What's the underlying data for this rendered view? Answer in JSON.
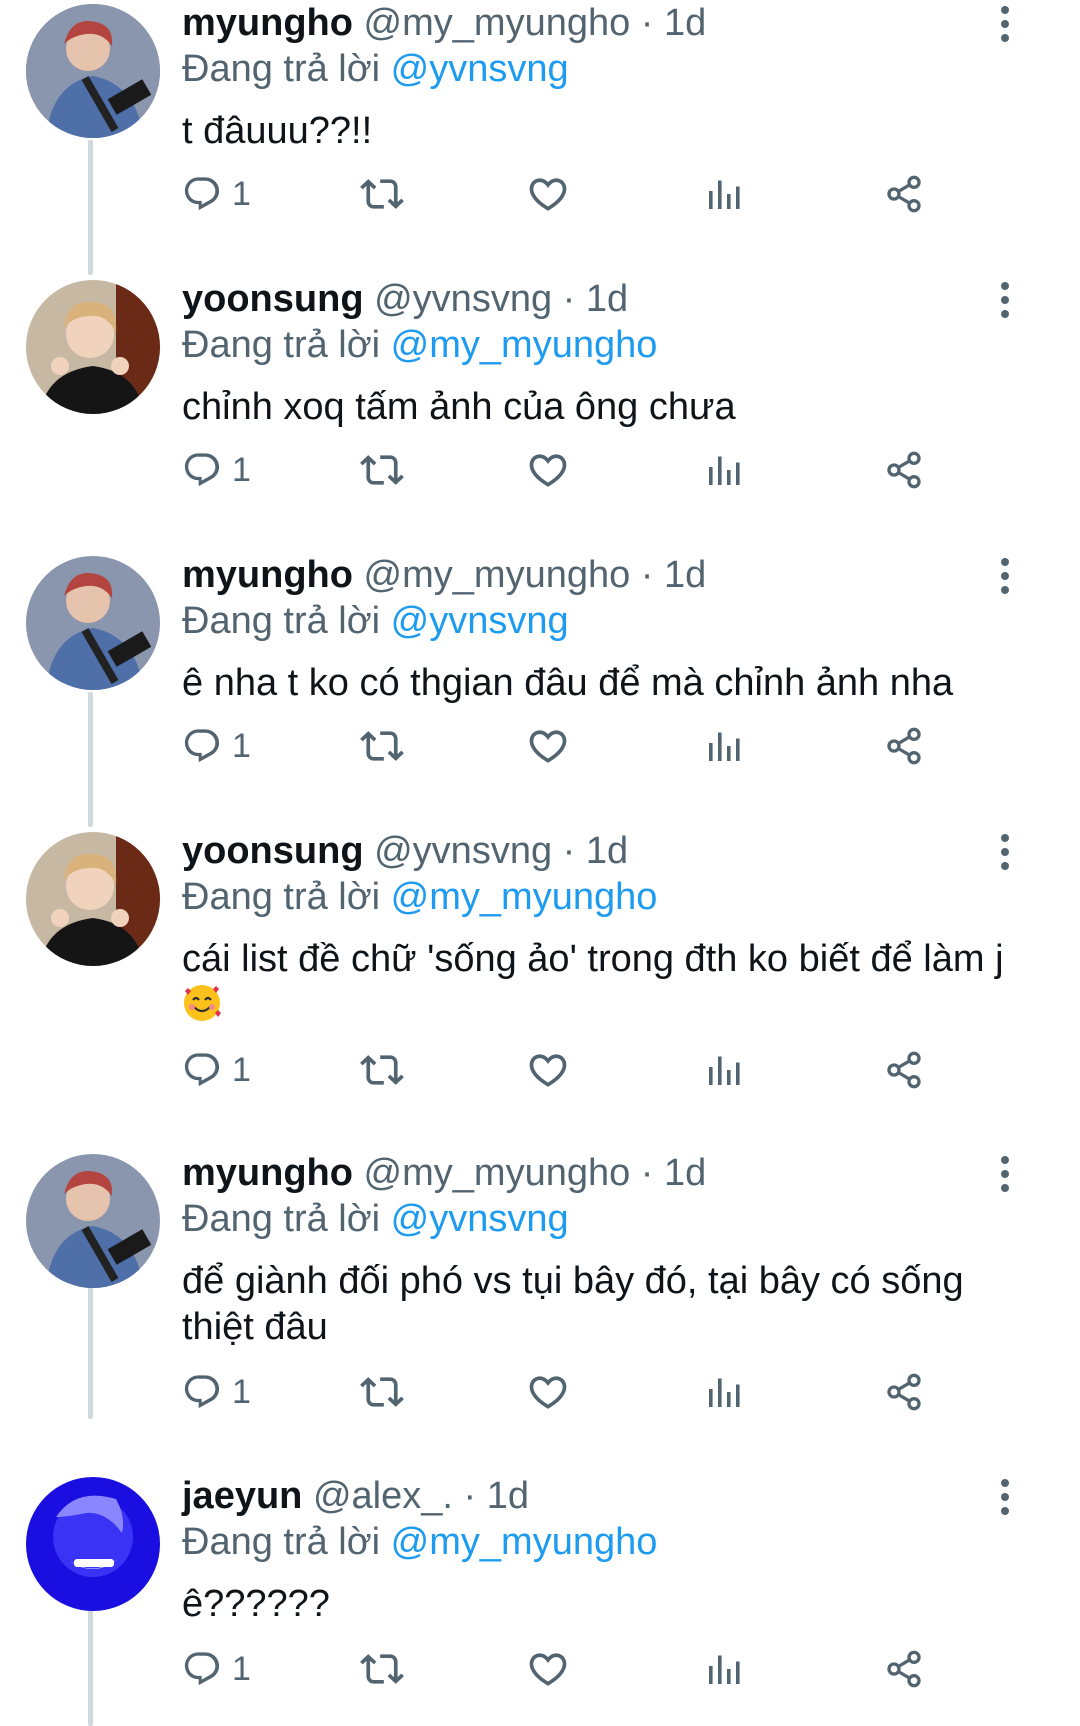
{
  "tweets": [
    {
      "display_name": "myungho",
      "handle": "@my_myungho",
      "time": "· 1d",
      "reply_prefix": "Đang trả lời",
      "reply_to": "@yvnsvng",
      "text": "t đâuuu??!!",
      "reply_count": "1",
      "avatar": "myungho-avatar"
    },
    {
      "display_name": "yoonsung",
      "handle": "@yvnsvng",
      "time": "· 1d",
      "reply_prefix": "Đang trả lời",
      "reply_to": "@my_myungho",
      "text": "chỉnh xoq tấm ảnh của ông chưa",
      "reply_count": "1",
      "avatar": "yoonsung-avatar"
    },
    {
      "display_name": "myungho",
      "handle": "@my_myungho",
      "time": "· 1d",
      "reply_prefix": "Đang trả lời",
      "reply_to": "@yvnsvng",
      "text": "ê nha t ko có thgian đâu để mà chỉnh ảnh nha",
      "reply_count": "1",
      "avatar": "myungho-avatar"
    },
    {
      "display_name": "yoonsung",
      "handle": "@yvnsvng",
      "time": "· 1d",
      "reply_prefix": "Đang trả lời",
      "reply_to": "@my_myungho",
      "text": "cái list đề chữ 'sống ảo' trong đth ko biết để làm j",
      "reply_count": "1",
      "avatar": "yoonsung-avatar",
      "emoji": "smiling-face-with-hearts-emoji"
    },
    {
      "display_name": "myungho",
      "handle": "@my_myungho",
      "time": "· 1d",
      "reply_prefix": "Đang trả lời",
      "reply_to": "@yvnsvng",
      "text": "để giành đối phó vs tụi bây đó, tại bây có sống thiệt đâu",
      "reply_count": "1",
      "avatar": "myungho-avatar"
    },
    {
      "display_name": "jaeyun",
      "handle": "@alex_.",
      "time": "· 1d",
      "reply_prefix": "Đang trả lời",
      "reply_to": "@my_myungho",
      "text": "ê??????",
      "reply_count": "1",
      "avatar": "jaeyun-avatar"
    }
  ],
  "icons": {
    "reply": "reply-icon",
    "retweet": "retweet-icon",
    "like": "heart-icon",
    "views": "bar-chart-icon",
    "share": "share-icon",
    "more": "more-vertical-icon"
  },
  "colors": {
    "mention": "#1d9bf0",
    "secondary_text": "#536471",
    "thread_line": "#cfd9de"
  }
}
